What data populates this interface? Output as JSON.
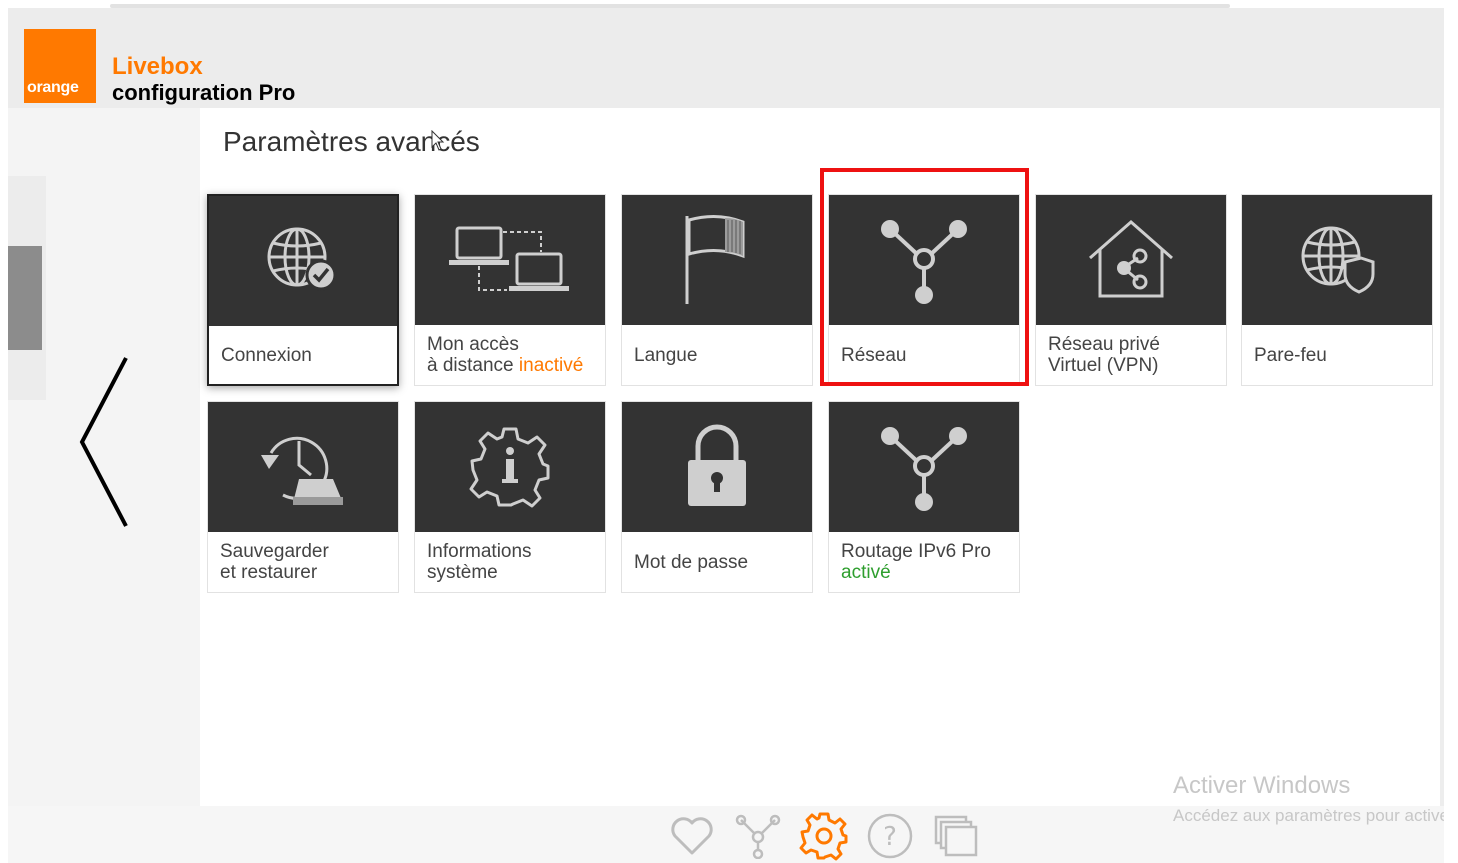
{
  "brand": {
    "logo_text": "orange",
    "title": "Livebox",
    "subtitle": "configuration Pro",
    "accent": "#ff7900"
  },
  "page": {
    "title": "Paramètres avancés"
  },
  "tiles": [
    {
      "label_line1": "Connexion",
      "icon": "globe-check-icon",
      "selected": true
    },
    {
      "label_line1": "Mon accès",
      "label_line2": "à distance",
      "status": "inactivé",
      "status_color": "#ff7900",
      "icon": "remote-computers-icon"
    },
    {
      "label_line1": "Langue",
      "icon": "flag-icon"
    },
    {
      "label_line1": "Réseau",
      "icon": "network-icon",
      "highlighted": true
    },
    {
      "label_line1": "Réseau privé",
      "label_line2": "Virtuel (VPN)",
      "icon": "vpn-house-icon"
    },
    {
      "label_line1": "Pare-feu",
      "icon": "globe-shield-icon"
    },
    {
      "label_line1": "Sauvegarder",
      "label_line2": "et restaurer",
      "icon": "backup-restore-icon"
    },
    {
      "label_line1": "Informations",
      "label_line2": "système",
      "icon": "info-gear-icon"
    },
    {
      "label_line1": "Mot de passe",
      "icon": "padlock-icon"
    },
    {
      "label_line1": "Routage IPv6 Pro",
      "status": "activé",
      "status_color": "#2e9e2e",
      "icon": "network-icon"
    }
  ],
  "highlight_color": "#ee1111",
  "toolbar": [
    {
      "icon": "heart-icon"
    },
    {
      "icon": "network-icon"
    },
    {
      "icon": "gear-icon",
      "active": true,
      "color": "#ff7900"
    },
    {
      "icon": "help-icon"
    },
    {
      "icon": "windows-icon"
    }
  ],
  "watermark": {
    "line1": "Activer Windows",
    "line2": "Accédez aux paramètres pour activer Windows."
  }
}
